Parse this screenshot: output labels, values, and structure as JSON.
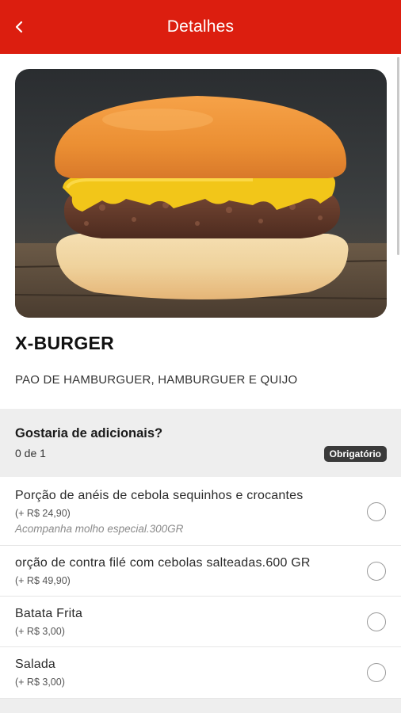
{
  "header": {
    "title": "Detalhes",
    "back_icon": "chevron-left-icon",
    "background_color": "#dc1e0f"
  },
  "product": {
    "image": "cheeseburger photo",
    "name": "X-BURGER",
    "description": "PAO DE HAMBURGUER, HAMBURGUER E QUIJO"
  },
  "addons": {
    "title": "Gostaria de adicionais?",
    "count": "0 de 1",
    "required_badge": "Obrigatório",
    "options": [
      {
        "name": "Porção de anéis de cebola sequinhos e crocantes",
        "price": "(+ R$ 24,90)",
        "note": "Acompanha molho especial.300GR",
        "selected": false
      },
      {
        "name": "orção de contra filé com cebolas salteadas.600 GR",
        "price": "(+ R$ 49,90)",
        "selected": false
      },
      {
        "name": "Batata Frita",
        "price": "(+ R$ 3,00)",
        "selected": false
      },
      {
        "name": "Salada",
        "price": "(+ R$ 3,00)",
        "selected": false
      }
    ]
  }
}
